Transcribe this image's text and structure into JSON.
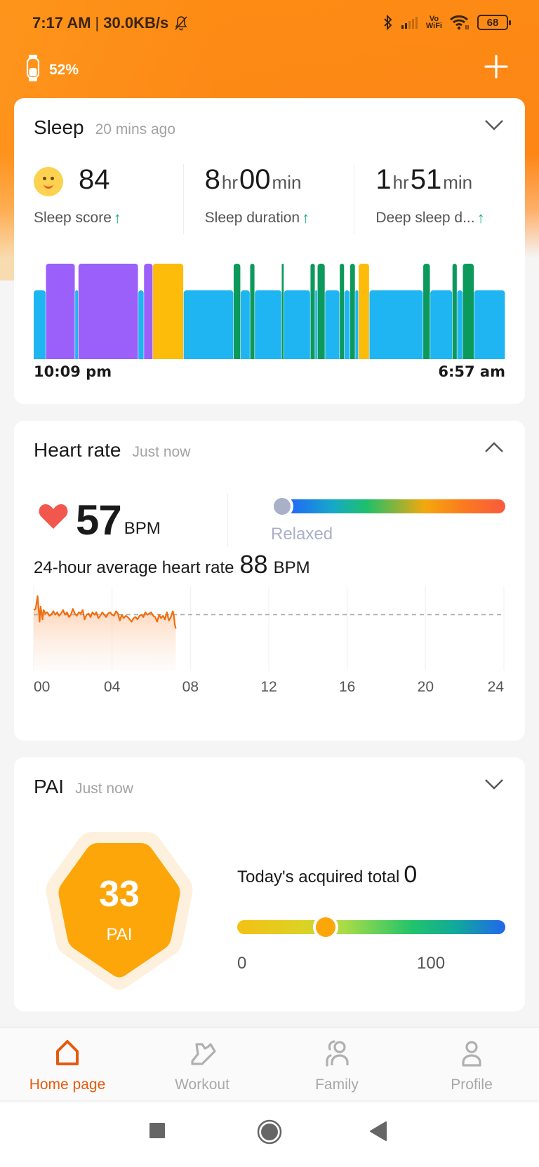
{
  "status_bar": {
    "time": "7:17 AM",
    "separator": "|",
    "network_speed": "30.0KB/s",
    "icons": [
      "bell-off-icon",
      "bluetooth-icon",
      "signal-icon",
      "vowifi-icon",
      "wifi-icon",
      "battery-icon"
    ],
    "vowifi_top": "Vo",
    "vowifi_bottom": "WiFi",
    "battery_level": "68"
  },
  "device": {
    "icon": "band-icon",
    "battery": "52%",
    "add_icon": "plus-icon"
  },
  "sleep": {
    "title": "Sleep",
    "updated": "20 mins ago",
    "toggle_icon": "chevron-down-icon",
    "score": "84",
    "score_label": "Sleep score",
    "duration_hr": "8",
    "duration_min": "00",
    "duration_label": "Sleep duration",
    "deep_hr": "1",
    "deep_min": "51",
    "deep_label": "Deep sleep d...",
    "unit_hr": "hr",
    "unit_min": "min",
    "trend_arrow": "↑",
    "start_time": "10:09 pm",
    "end_time": "6:57 am",
    "colors": {
      "light": "#1fb5f2",
      "deep": "#9b5ffa",
      "awake": "#fdbb0a",
      "rem": "#0c9a5c"
    }
  },
  "heart_rate": {
    "title": "Heart rate",
    "updated": "Just now",
    "toggle_icon": "chevron-up-icon",
    "current": "57",
    "unit": "BPM",
    "zone": "Relaxed",
    "zone_position": 0.0,
    "avg_label": "24-hour average heart rate",
    "avg_value": "88",
    "avg_unit": "BPM"
  },
  "pai": {
    "title": "PAI",
    "updated": "Just now",
    "toggle_icon": "chevron-down-icon",
    "value": "33",
    "label": "PAI",
    "today_label": "Today's acquired total",
    "today_value": "0",
    "scale_min": "0",
    "scale_max": "100",
    "scale_value": 33
  },
  "bottom_nav": [
    {
      "label": "Home page",
      "icon": "home-icon",
      "active": true
    },
    {
      "label": "Workout",
      "icon": "shoe-icon",
      "active": false
    },
    {
      "label": "Family",
      "icon": "family-icon",
      "active": false
    },
    {
      "label": "Profile",
      "icon": "profile-icon",
      "active": false
    }
  ],
  "system_nav": [
    "recents-button",
    "home-button",
    "back-button"
  ],
  "chart_data": [
    {
      "type": "bar",
      "title": "Sleep stages",
      "xlabel": "",
      "ylabel": "",
      "x_range": [
        "10:09 pm",
        "6:57 am"
      ],
      "stage_levels": {
        "light": 1,
        "deep": 2,
        "awake": 2,
        "rem": 2
      },
      "segments_fraction": [
        {
          "stage": "light",
          "start": 0.0,
          "end": 0.026
        },
        {
          "stage": "deep",
          "start": 0.026,
          "end": 0.088
        },
        {
          "stage": "light",
          "start": 0.088,
          "end": 0.095
        },
        {
          "stage": "deep",
          "start": 0.095,
          "end": 0.222
        },
        {
          "stage": "light",
          "start": 0.222,
          "end": 0.234
        },
        {
          "stage": "deep",
          "start": 0.234,
          "end": 0.253
        },
        {
          "stage": "awake",
          "start": 0.253,
          "end": 0.318
        },
        {
          "stage": "light",
          "start": 0.318,
          "end": 0.424
        },
        {
          "stage": "rem",
          "start": 0.424,
          "end": 0.439
        },
        {
          "stage": "light",
          "start": 0.439,
          "end": 0.459
        },
        {
          "stage": "rem",
          "start": 0.459,
          "end": 0.469
        },
        {
          "stage": "light",
          "start": 0.469,
          "end": 0.526
        },
        {
          "stage": "rem",
          "start": 0.526,
          "end": 0.531
        },
        {
          "stage": "light",
          "start": 0.531,
          "end": 0.587
        },
        {
          "stage": "rem",
          "start": 0.587,
          "end": 0.597
        },
        {
          "stage": "light",
          "start": 0.597,
          "end": 0.602
        },
        {
          "stage": "rem",
          "start": 0.602,
          "end": 0.618
        },
        {
          "stage": "light",
          "start": 0.618,
          "end": 0.649
        },
        {
          "stage": "rem",
          "start": 0.649,
          "end": 0.659
        },
        {
          "stage": "light",
          "start": 0.659,
          "end": 0.671
        },
        {
          "stage": "rem",
          "start": 0.671,
          "end": 0.682
        },
        {
          "stage": "light",
          "start": 0.682,
          "end": 0.689
        },
        {
          "stage": "awake",
          "start": 0.689,
          "end": 0.712
        },
        {
          "stage": "light",
          "start": 0.712,
          "end": 0.826
        },
        {
          "stage": "rem",
          "start": 0.826,
          "end": 0.841
        },
        {
          "stage": "light",
          "start": 0.841,
          "end": 0.888
        },
        {
          "stage": "rem",
          "start": 0.888,
          "end": 0.898
        },
        {
          "stage": "light",
          "start": 0.898,
          "end": 0.91
        },
        {
          "stage": "rem",
          "start": 0.91,
          "end": 0.934
        },
        {
          "stage": "light",
          "start": 0.934,
          "end": 1.0
        }
      ]
    },
    {
      "type": "area",
      "title": "24-hour heart rate",
      "xlabel": "",
      "ylabel": "BPM",
      "x_ticks": [
        "00",
        "04",
        "08",
        "12",
        "16",
        "20",
        "24"
      ],
      "x_range": [
        0,
        24
      ],
      "y_range": [
        40,
        110
      ],
      "average": 88,
      "grid": true,
      "x": [
        0.0,
        0.1,
        0.2,
        0.3,
        0.35,
        0.45,
        0.5,
        0.6,
        0.7,
        0.8,
        0.9,
        1.0,
        1.1,
        1.2,
        1.3,
        1.4,
        1.5,
        1.6,
        1.7,
        1.8,
        1.9,
        2.0,
        2.1,
        2.2,
        2.3,
        2.4,
        2.5,
        2.6,
        2.7,
        2.8,
        2.9,
        3.0,
        3.1,
        3.2,
        3.3,
        3.4,
        3.5,
        3.6,
        3.7,
        3.8,
        3.9,
        4.0,
        4.1,
        4.2,
        4.3,
        4.4,
        4.5,
        4.6,
        4.7,
        4.8,
        4.9,
        5.0,
        5.1,
        5.2,
        5.3,
        5.4,
        5.5,
        5.6,
        5.7,
        5.8,
        5.9,
        6.0,
        6.1,
        6.2,
        6.3,
        6.4,
        6.5,
        6.6,
        6.7,
        6.8,
        6.9,
        7.0,
        7.1,
        7.15,
        7.2,
        7.25
      ],
      "y": [
        92,
        93,
        104,
        82,
        95,
        84,
        92,
        89,
        90,
        87,
        88,
        91,
        88,
        90,
        87,
        89,
        92,
        88,
        90,
        86,
        88,
        93,
        89,
        87,
        90,
        89,
        92,
        84,
        88,
        89,
        86,
        90,
        88,
        90,
        85,
        87,
        90,
        88,
        86,
        89,
        90,
        88,
        87,
        91,
        89,
        83,
        88,
        85,
        87,
        86,
        84,
        82,
        85,
        86,
        84,
        87,
        88,
        86,
        90,
        88,
        89,
        90,
        87,
        86,
        82,
        88,
        85,
        87,
        84,
        90,
        83,
        86,
        91,
        88,
        80,
        76
      ]
    }
  ]
}
